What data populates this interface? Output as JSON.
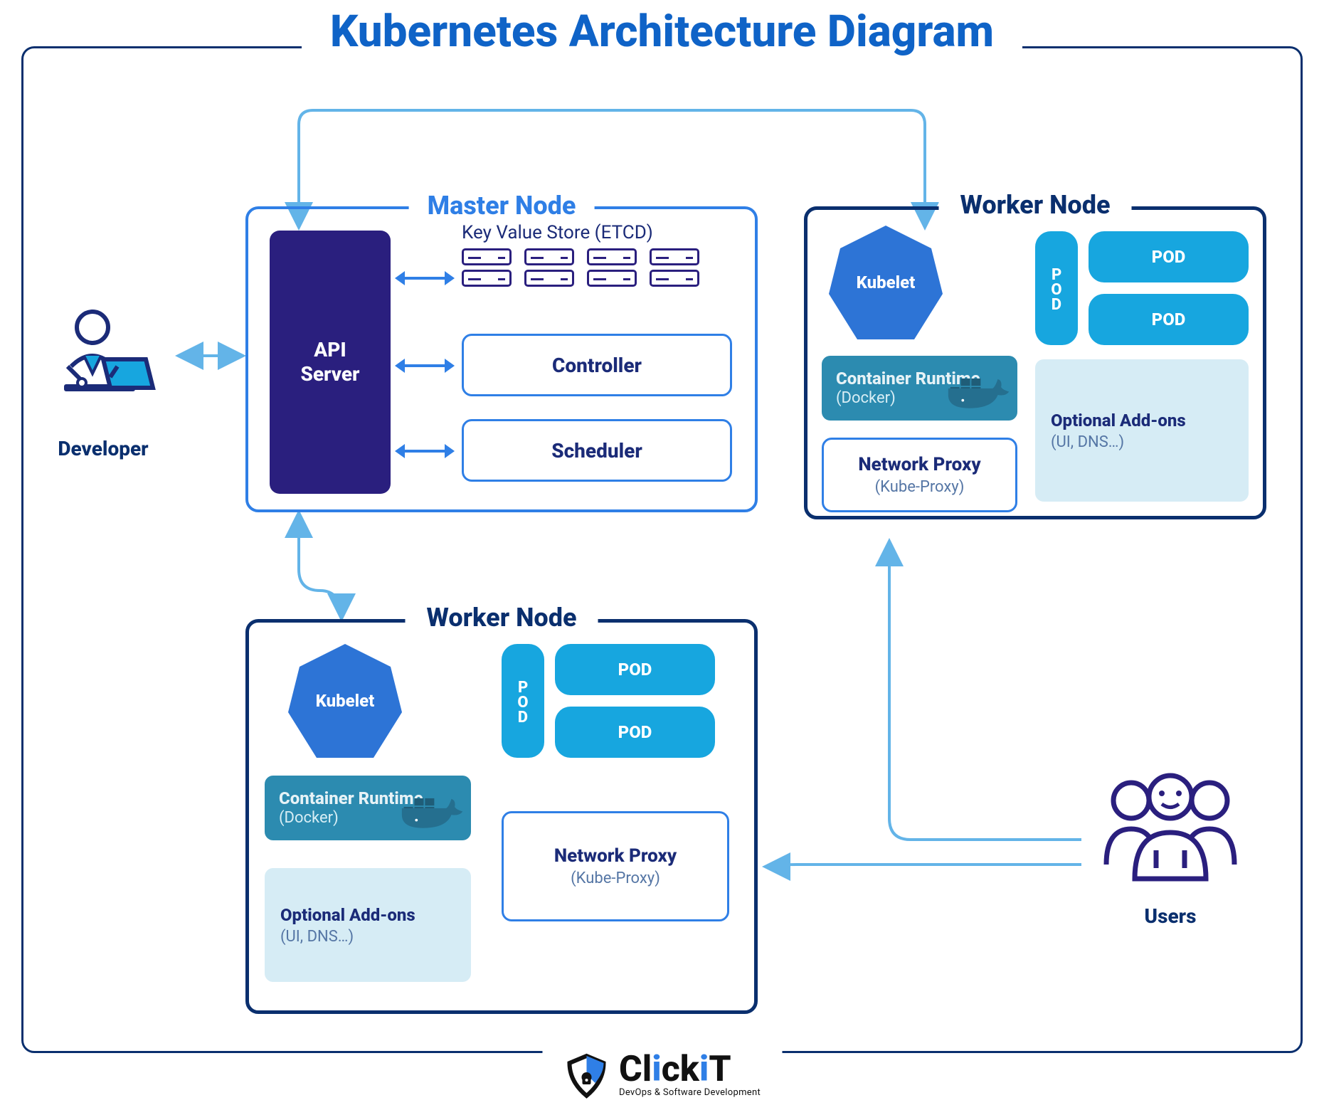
{
  "title": "Kubernetes Architecture Diagram",
  "developer": {
    "label": "Developer"
  },
  "users": {
    "label": "Users"
  },
  "master": {
    "title": "Master Node",
    "api_server": "API\nServer",
    "etcd_label": "Key Value Store (ETCD)",
    "controller": "Controller",
    "scheduler": "Scheduler"
  },
  "worker1": {
    "title": "Worker Node",
    "kubelet": "Kubelet",
    "container_runtime": {
      "title": "Container Runtime",
      "subtitle": "(Docker)"
    },
    "network_proxy": {
      "title": "Network Proxy",
      "subtitle": "(Kube-Proxy)"
    },
    "addons": {
      "title": "Optional Add-ons",
      "subtitle": "(UI, DNS…)"
    },
    "pods": [
      "POD",
      "POD",
      "POD"
    ]
  },
  "worker2": {
    "title": "Worker Node",
    "kubelet": "Kubelet",
    "container_runtime": {
      "title": "Container Runtime",
      "subtitle": "(Docker)"
    },
    "network_proxy": {
      "title": "Network Proxy",
      "subtitle": "(Kube-Proxy)"
    },
    "addons": {
      "title": "Optional Add-ons",
      "subtitle": "(UI, DNS…)"
    },
    "pods": [
      "POD",
      "POD",
      "POD"
    ]
  },
  "logo": {
    "name": "ClickIT",
    "tagline": "DevOps & Software Development"
  },
  "colors": {
    "frame": "#0a2f6e",
    "accent": "#2f7fe6",
    "api_bg": "#2a1f7e",
    "pod_bg": "#17a6df",
    "runtime_bg": "#2c8bb0",
    "addons_bg": "#d6ecf5",
    "arrow": "#63b4e8"
  }
}
